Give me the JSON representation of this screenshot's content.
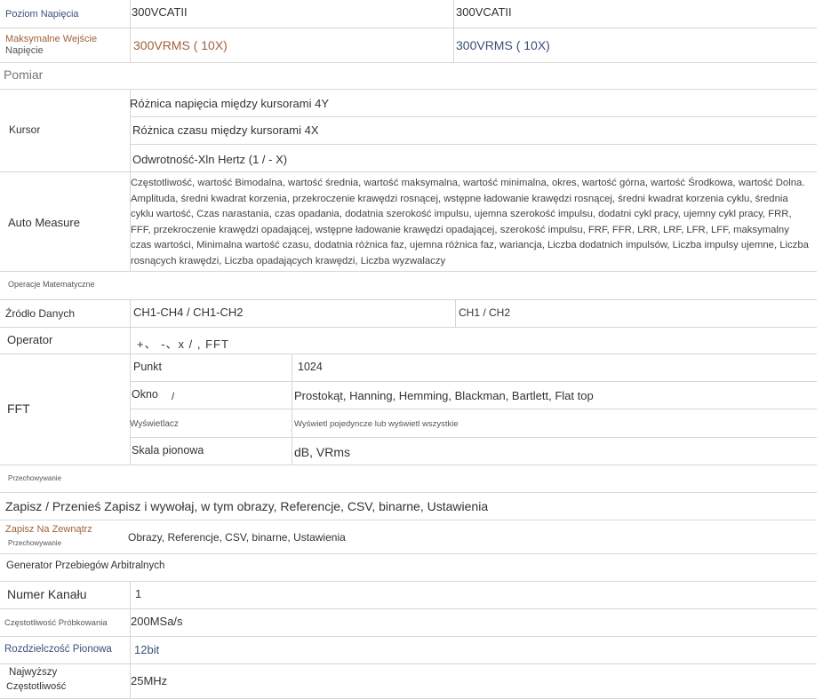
{
  "rows": {
    "poziom": {
      "label": "Poziom Napięcia",
      "col1": "300VCATII",
      "col2": "300VCATII"
    },
    "max_wejscie": {
      "label_line1": "Maksymalne Wejście",
      "label_line2": "Napięcie",
      "col1": "300VRMS ( 10X)",
      "col2": "300VRMS ( 10X)"
    },
    "pomiar": {
      "label": "Pomiar"
    },
    "kursor": {
      "label": "Kursor",
      "items": [
        "Różnica napięcia między kursorami 4Y",
        "Różnica czasu między kursorami 4X",
        "Odwrotność-Xln Hertz (1 / - X)"
      ]
    },
    "auto_measure": {
      "label": "Auto Measure",
      "text": "Częstotliwość, wartość Bimodalna, wartość średnia, wartość maksymalna, wartość minimalna, okres, wartość górna, wartość Środkowa, wartość Dolna. Amplituda, średni kwadrat korzenia, przekroczenie krawędzi rosnącej, wstępne ładowanie krawędzi rosnącej, średni kwadrat korzenia cyklu, średnia cyklu wartość, Czas narastania, czas opadania, dodatnia szerokość impulsu, ujemna szerokość impulsu, dodatni cykl pracy, ujemny cykl pracy, FRR, FFF, przekroczenie krawędzi opadającej, wstępne ładowanie krawędzi opadającej, szerokość impulsu, FRF, FFR, LRR, LRF, LFR, LFF, maksymalny czas wartości, Minimalna wartość czasu, dodatnia różnica faz, ujemna różnica faz, wariancja, Liczba dodatnich impulsów, Liczba impulsy ujemne, Liczba rosnących krawędzi, Liczba opadających krawędzi, Liczba wyzwalaczy"
    },
    "operacje": {
      "label": "Operacje Matematyczne"
    },
    "zrodlo": {
      "label": "Źródło Danych",
      "col1": "CH1-CH4 / CH1-CH2",
      "col2": "CH1 / CH2"
    },
    "operator": {
      "label": "Operator",
      "value": "+、 -、x / , FFT"
    },
    "fft": {
      "label": "FFT",
      "items": [
        {
          "name": "Punkt",
          "value": "1024"
        },
        {
          "name": "Okno",
          "extra": "/",
          "value": "Prostokąt, Hanning, Hemming, Blackman, Bartlett, Flat top"
        },
        {
          "name": "Wyświetlacz",
          "value": "Wyświetl pojedyncze lub wyświetl wszystkie"
        },
        {
          "name": "Skala pionowa",
          "value": "dB, VRms"
        }
      ]
    },
    "przechowywanie": {
      "label": "Przechowywanie"
    },
    "zapisz": {
      "value": "Zapisz / Przenieś Zapisz i wywołaj, w tym obrazy, Referencje, CSV, binarne, Ustawienia"
    },
    "zapisz_zew": {
      "label_line1": "Zapisz Na Zewnątrz",
      "label_line2": "Przechowywanie",
      "value": "Obrazy, Referencje, CSV, binarne, Ustawienia"
    },
    "generator": {
      "label": "Generator Przebiegów Arbitralnych"
    },
    "numer_kanalu": {
      "label": "Numer Kanału",
      "value": "1"
    },
    "czestotliwosc_prob": {
      "label": "Częstotliwość Próbkowania",
      "value": "200MSa/s"
    },
    "rozdzielczosc": {
      "label": "Rozdzielczość Pionowa",
      "value": "12bit"
    },
    "najwyzsza": {
      "label_line1": "Najwyższy",
      "label_line2": "Częstotliwość",
      "value": "25MHz"
    }
  }
}
